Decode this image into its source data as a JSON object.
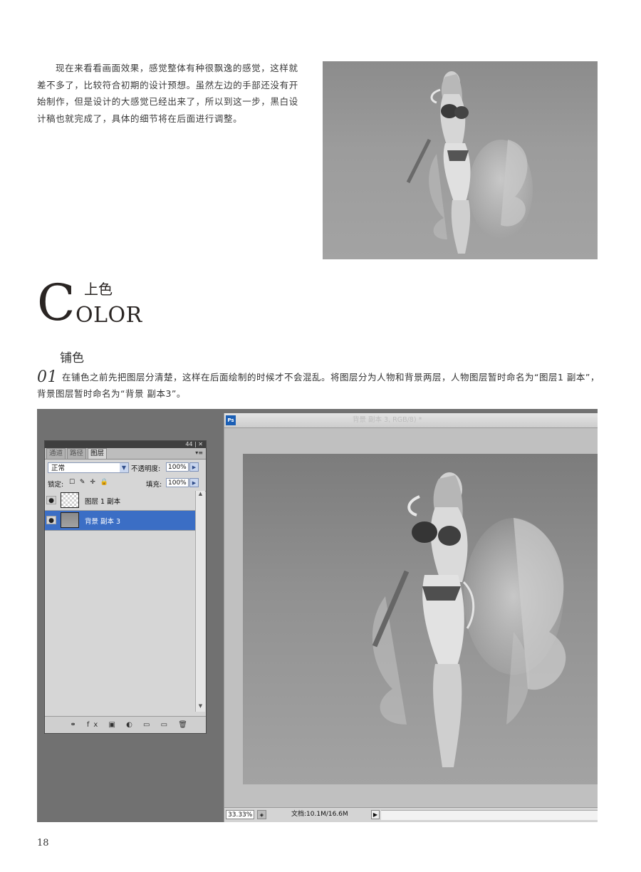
{
  "intro": {
    "text": "现在来看看画面效果，感觉整体有种很飘逸的感觉，这样就差不多了，比较符合初期的设计预想。虽然左边的手部还没有开始制作，但是设计的大感觉已经出来了，所以到这一步，黑白设计稿也就完成了，具体的细节将在后面进行调整。"
  },
  "section": {
    "title_cn": "上色",
    "title_en_initial": "C",
    "title_en_rest": "OLOR"
  },
  "subheading": "铺色",
  "step": {
    "number": "01",
    "text": "在铺色之前先把图层分清楚，这样在后面绘制的时候才不会混乱。将图层分为人物和背景两层，人物图层暂时命名为“图层1 副本”，背景图层暂时命名为“背景 副本3”。"
  },
  "photoshop": {
    "panel_controls": "44 | ✕",
    "tabs": [
      "通道",
      "路径",
      "图层"
    ],
    "active_tab": "图层",
    "panel_menu": "▾≡",
    "blend_mode": "正常",
    "opacity_label": "不透明度:",
    "opacity_value": "100%",
    "lock_label": "锁定:",
    "lock_icons": "☐ ✎ ✛ 🔒",
    "fill_label": "填充:",
    "fill_value": "100%",
    "layers": [
      {
        "name": "图层 1 副本",
        "selected": false
      },
      {
        "name": "背景 副本 3",
        "selected": true
      }
    ],
    "footer_icons": "⚭ fx ▣ ◐ ▭ ▭ 🗑",
    "ps_logo": "Ps",
    "doc_title": "背景 副本 3, RGB/8) *",
    "zoom": "33.33%",
    "doc_info": "文档:10.1M/16.6M"
  },
  "page_number": "18"
}
